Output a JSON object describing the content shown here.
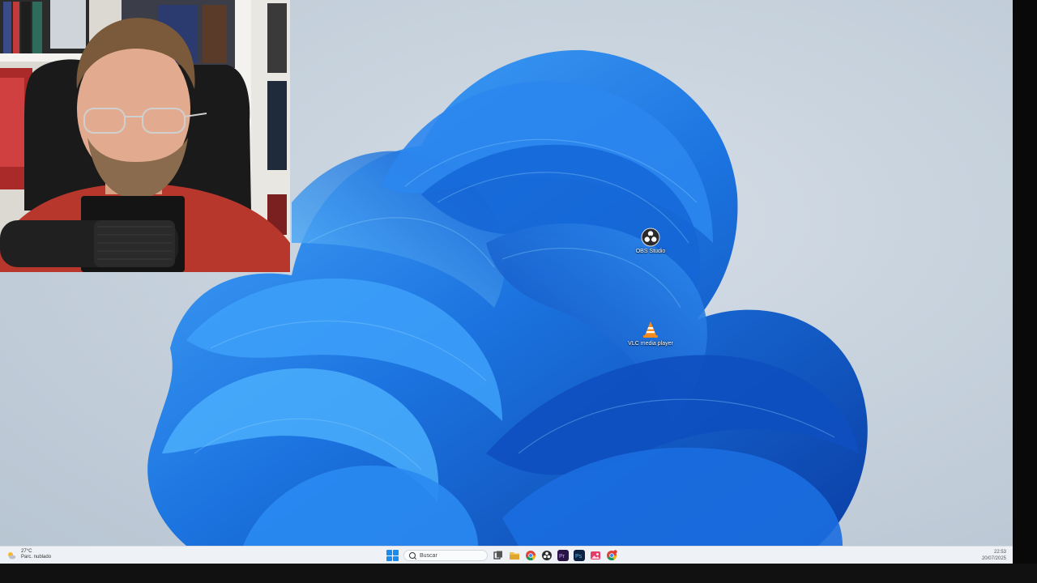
{
  "desktop": {
    "icons": [
      {
        "label": "OBS Studio",
        "icon": "obs-icon"
      },
      {
        "label": "VLC media player",
        "icon": "vlc-icon"
      }
    ]
  },
  "taskbar": {
    "weather": {
      "temp": "27°C",
      "condition": "Parc. nublado",
      "icon": "partly-cloudy-icon"
    },
    "search_placeholder": "Buscar",
    "apps": [
      {
        "name": "task-view",
        "icon": "task-view-icon"
      },
      {
        "name": "file-explorer",
        "icon": "folder-icon"
      },
      {
        "name": "chrome",
        "icon": "chrome-icon"
      },
      {
        "name": "obs",
        "icon": "obs-icon"
      },
      {
        "name": "premiere",
        "icon": "premiere-pro-icon",
        "text": "Pr"
      },
      {
        "name": "photoshop",
        "icon": "photoshop-icon",
        "text": "Ps"
      },
      {
        "name": "gallery",
        "icon": "photos-icon"
      },
      {
        "name": "chrome-profile",
        "icon": "chrome-icon"
      }
    ],
    "clock": {
      "time": "22:53",
      "date": "20/07/2025"
    }
  },
  "colors": {
    "accent": "#1a8cf0",
    "bloom_dark": "#0b4fc4",
    "bloom_light": "#3aa0f5",
    "desktop_bg": "#c7d2dd",
    "taskbar_bg": "#eef1f5"
  }
}
